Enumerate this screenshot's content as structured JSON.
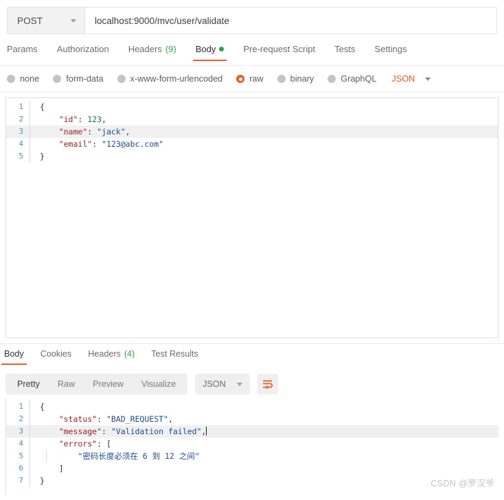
{
  "request": {
    "method": "POST",
    "url": "localhost:9000/mvc/user/validate",
    "tabs": [
      {
        "label": "Params",
        "count": "",
        "active": false,
        "dot": false
      },
      {
        "label": "Authorization",
        "count": "",
        "active": false,
        "dot": false
      },
      {
        "label": "Headers",
        "count": "(9)",
        "active": false,
        "dot": false
      },
      {
        "label": "Body",
        "count": "",
        "active": true,
        "dot": true
      },
      {
        "label": "Pre-request Script",
        "count": "",
        "active": false,
        "dot": false
      },
      {
        "label": "Tests",
        "count": "",
        "active": false,
        "dot": false
      },
      {
        "label": "Settings",
        "count": "",
        "active": false,
        "dot": false
      }
    ],
    "body_types": [
      {
        "label": "none",
        "selected": false
      },
      {
        "label": "form-data",
        "selected": false
      },
      {
        "label": "x-www-form-urlencoded",
        "selected": false
      },
      {
        "label": "raw",
        "selected": true
      },
      {
        "label": "binary",
        "selected": false
      },
      {
        "label": "GraphQL",
        "selected": false
      }
    ],
    "raw_format": "JSON",
    "body_lines": [
      {
        "n": "1",
        "highlight": false,
        "indent_guide": false,
        "tokens": [
          {
            "t": "{",
            "c": "tok-brace"
          }
        ]
      },
      {
        "n": "2",
        "highlight": false,
        "indent_guide": false,
        "tokens": [
          {
            "t": "    ",
            "c": "tok-punc"
          },
          {
            "t": "\"id\"",
            "c": "tok-key"
          },
          {
            "t": ": ",
            "c": "tok-punc"
          },
          {
            "t": "123",
            "c": "tok-num"
          },
          {
            "t": ",",
            "c": "tok-punc"
          }
        ]
      },
      {
        "n": "3",
        "highlight": true,
        "indent_guide": false,
        "tokens": [
          {
            "t": "    ",
            "c": "tok-punc"
          },
          {
            "t": "\"name\"",
            "c": "tok-key"
          },
          {
            "t": ": ",
            "c": "tok-punc"
          },
          {
            "t": "\"jack\"",
            "c": "tok-str"
          },
          {
            "t": ",",
            "c": "tok-punc"
          }
        ]
      },
      {
        "n": "4",
        "highlight": false,
        "indent_guide": false,
        "tokens": [
          {
            "t": "    ",
            "c": "tok-punc"
          },
          {
            "t": "\"email\"",
            "c": "tok-key"
          },
          {
            "t": ": ",
            "c": "tok-punc"
          },
          {
            "t": "\"123@abc.com\"",
            "c": "tok-str"
          }
        ]
      },
      {
        "n": "5",
        "highlight": false,
        "indent_guide": false,
        "tokens": [
          {
            "t": "}",
            "c": "tok-brace"
          }
        ]
      }
    ]
  },
  "response": {
    "tabs": [
      {
        "label": "Body",
        "count": "",
        "active": true
      },
      {
        "label": "Cookies",
        "count": "",
        "active": false
      },
      {
        "label": "Headers",
        "count": "(4)",
        "active": false
      },
      {
        "label": "Test Results",
        "count": "",
        "active": false
      }
    ],
    "view_modes": [
      {
        "label": "Pretty",
        "active": true
      },
      {
        "label": "Raw",
        "active": false
      },
      {
        "label": "Preview",
        "active": false
      },
      {
        "label": "Visualize",
        "active": false
      }
    ],
    "format": "JSON",
    "wrap_icon": "word-wrap-icon",
    "body_lines": [
      {
        "n": "1",
        "highlight": false,
        "indent_guide": false,
        "caret": false,
        "tokens": [
          {
            "t": "{",
            "c": "tok-brace"
          }
        ]
      },
      {
        "n": "2",
        "highlight": false,
        "indent_guide": false,
        "caret": false,
        "tokens": [
          {
            "t": "    ",
            "c": "tok-punc"
          },
          {
            "t": "\"status\"",
            "c": "tok-key"
          },
          {
            "t": ": ",
            "c": "tok-punc"
          },
          {
            "t": "\"BAD_REQUEST\"",
            "c": "tok-str"
          },
          {
            "t": ",",
            "c": "tok-punc"
          }
        ]
      },
      {
        "n": "3",
        "highlight": true,
        "indent_guide": false,
        "caret": true,
        "tokens": [
          {
            "t": "    ",
            "c": "tok-punc"
          },
          {
            "t": "\"message\"",
            "c": "tok-key"
          },
          {
            "t": ": ",
            "c": "tok-punc"
          },
          {
            "t": "\"Validation failed\"",
            "c": "tok-str"
          },
          {
            "t": ",",
            "c": "tok-punc"
          }
        ]
      },
      {
        "n": "4",
        "highlight": false,
        "indent_guide": false,
        "caret": false,
        "tokens": [
          {
            "t": "    ",
            "c": "tok-punc"
          },
          {
            "t": "\"errors\"",
            "c": "tok-key"
          },
          {
            "t": ": [",
            "c": "tok-punc"
          }
        ]
      },
      {
        "n": "5",
        "highlight": false,
        "indent_guide": true,
        "caret": false,
        "tokens": [
          {
            "t": "        ",
            "c": "tok-punc"
          },
          {
            "t": "\"密码长度必须在 6 到 12 之间\"",
            "c": "tok-str"
          }
        ]
      },
      {
        "n": "6",
        "highlight": false,
        "indent_guide": false,
        "caret": false,
        "tokens": [
          {
            "t": "    ]",
            "c": "tok-punc"
          }
        ]
      },
      {
        "n": "7",
        "highlight": false,
        "indent_guide": false,
        "caret": false,
        "tokens": [
          {
            "t": "}",
            "c": "tok-brace"
          }
        ]
      }
    ]
  },
  "watermark": "CSDN @罗汉爷",
  "colors": {
    "accent": "#ef5b25",
    "green": "#3fa14a",
    "dot_green": "#1ba94c",
    "gutter": "#2a7fa8",
    "key": "#9b1f1f",
    "string": "#1a4b9c",
    "number": "#1a7a2e"
  }
}
